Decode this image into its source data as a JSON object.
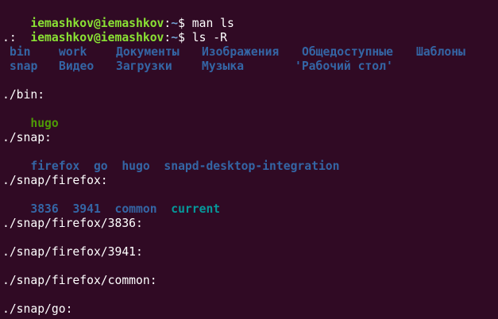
{
  "theme": {
    "background": "#300a24",
    "prompt_user_color": "#8ae234",
    "prompt_path_color": "#729fcf",
    "directory_color": "#3465a4",
    "executable_color": "#4e9a06",
    "symlink_color": "#06989a",
    "text_color": "#ffffff"
  },
  "prompts": [
    {
      "user_host": "iemashkov@iemashkov",
      "sep": ":",
      "path": "~",
      "dollar": "$",
      "command": " man ls"
    },
    {
      "user_host": "iemashkov@iemashkov",
      "sep": ":",
      "path": "~",
      "dollar": "$",
      "command": " ls -R"
    }
  ],
  "output": {
    "root_header": ".:",
    "root_row1": [
      "bin",
      "work",
      "Документы",
      "Изображения",
      "Общедоступные",
      "Шаблоны"
    ],
    "root_row2": [
      "snap",
      "Видео",
      "Загрузки",
      "Музыка",
      "'Рабочий стол'"
    ],
    "bin_header": "./bin:",
    "bin_files": [
      "hugo"
    ],
    "snap_header": "./snap:",
    "snap_entries": [
      "firefox",
      "go",
      "hugo",
      "snapd-desktop-integration"
    ],
    "firefox_header": "./snap/firefox:",
    "firefox_entries": [
      "3836",
      "3941",
      "common",
      "current"
    ],
    "firefox_3836_header": "./snap/firefox/3836:",
    "firefox_3941_header": "./snap/firefox/3941:",
    "firefox_common_header": "./snap/firefox/common:",
    "go_header": "./snap/go:"
  }
}
